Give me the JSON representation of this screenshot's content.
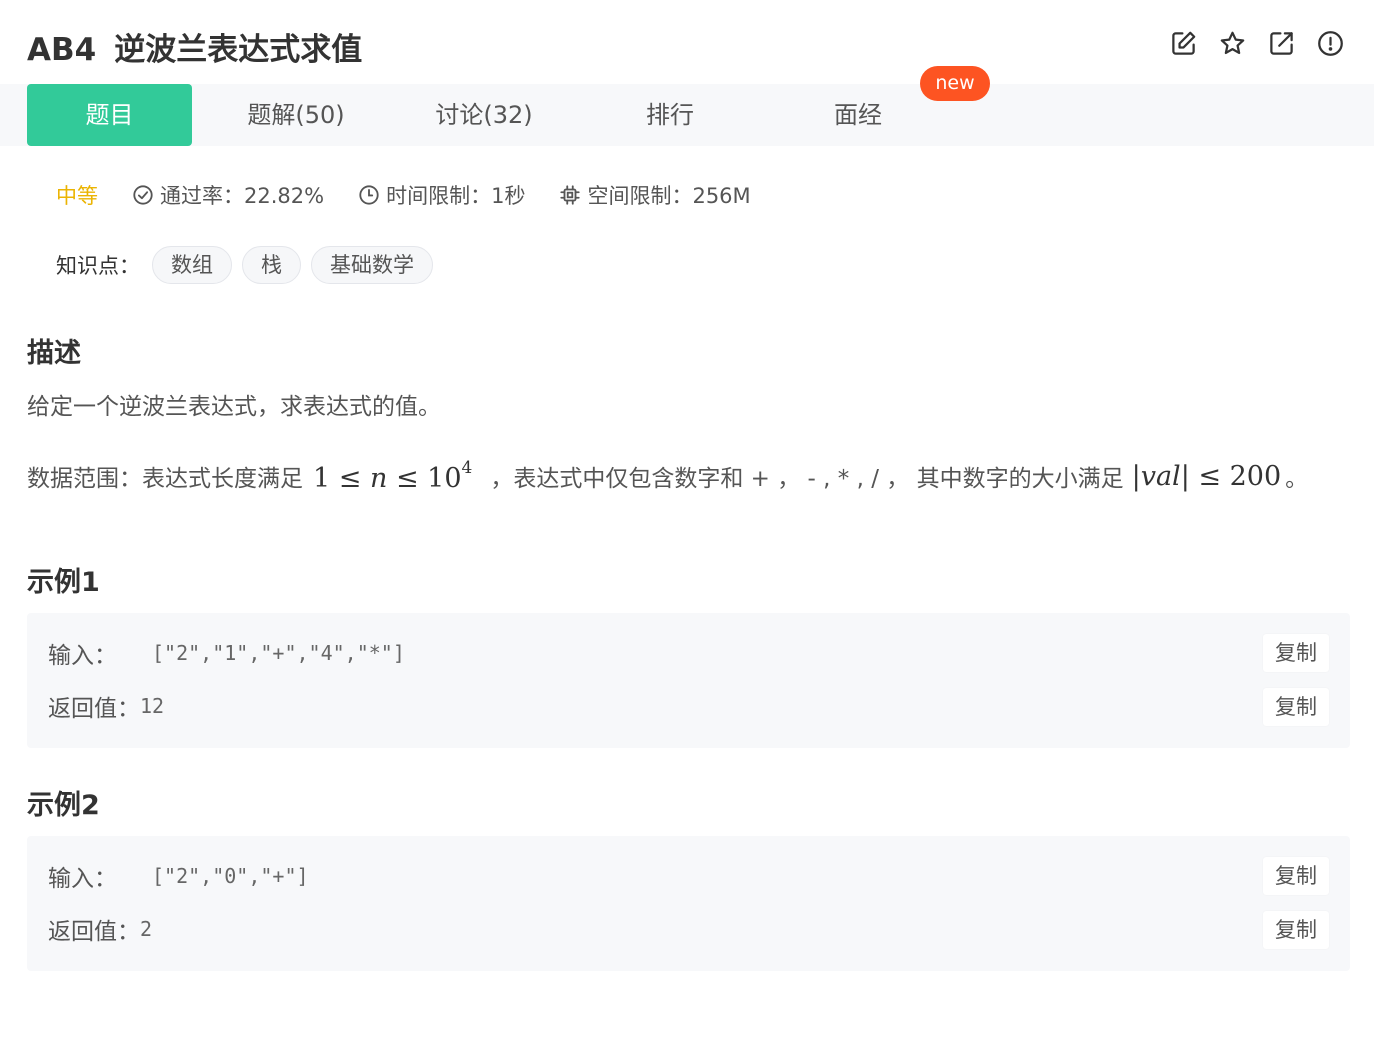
{
  "header": {
    "problem_code": "AB4",
    "problem_title": "逆波兰表达式求值",
    "icons": [
      "edit-icon",
      "star-icon",
      "open-external-icon",
      "alert-circle-icon"
    ]
  },
  "tabs": [
    {
      "label": "题目",
      "active": true
    },
    {
      "label": "题解(50)",
      "active": false
    },
    {
      "label": "讨论(32)",
      "active": false
    },
    {
      "label": "排行",
      "active": false
    },
    {
      "label": "面经",
      "active": false
    }
  ],
  "new_badge": "new",
  "meta": {
    "difficulty": "中等",
    "pass_rate": "通过率：22.82%",
    "time_limit": "时间限制：1秒",
    "memory_limit": "空间限制：256M"
  },
  "knowledge": {
    "label": "知识点：",
    "tags": [
      "数组",
      "栈",
      "基础数学"
    ]
  },
  "description": {
    "title": "描述",
    "text": "给定一个逆波兰表达式，求表达式的值。",
    "range_prefix": "数据范围：表达式长度满足",
    "range_middle": "，表达式中仅包含数字和 + ， - , * , / ， 其中数字的大小满足",
    "range_suffix": "。"
  },
  "examples": [
    {
      "title": "示例1",
      "input_label": "输入：",
      "input_value": "[\"2\",\"1\",\"+\",\"4\",\"*\"]",
      "output_label": "返回值：",
      "output_value": "12",
      "copy_label": "复制"
    },
    {
      "title": "示例2",
      "input_label": "输入：",
      "input_value": "[\"2\",\"0\",\"+\"]",
      "output_label": "返回值：",
      "output_value": "2",
      "copy_label": "复制"
    }
  ],
  "colors": {
    "accent": "#32ca99",
    "difficulty": "#ebb403",
    "badge": "#fd5422",
    "panel_bg": "#f7f8fa"
  }
}
